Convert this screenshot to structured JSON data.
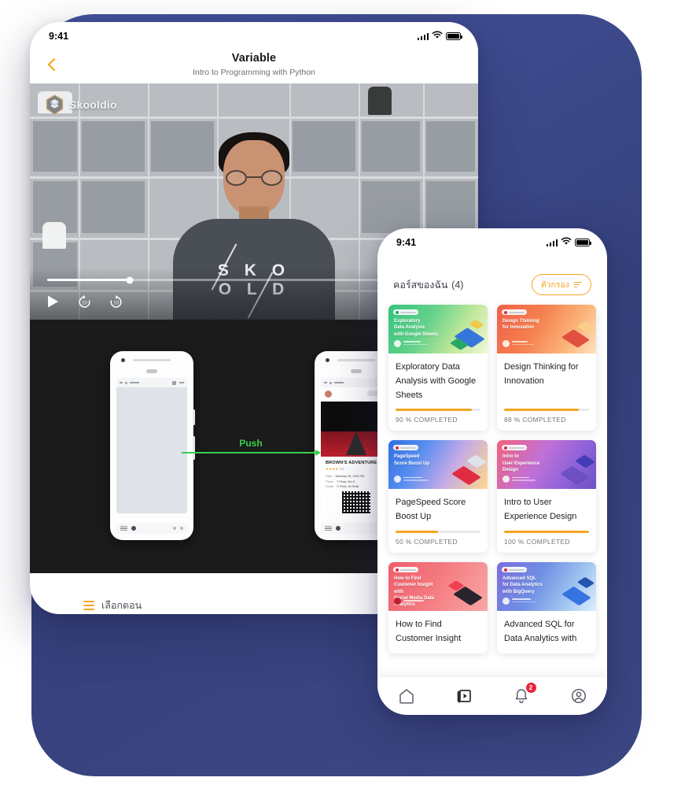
{
  "background": {
    "blob_color": "#3f4c92",
    "page_background": "#ffffff"
  },
  "colors": {
    "accent_orange": "#f5a623",
    "badge_red": "#e8253a",
    "push_green": "#36d04a",
    "text_dark": "#1c1f25",
    "text_muted": "#73787f"
  },
  "phone_lesson": {
    "status_bar": {
      "time": "9:41",
      "signal_icon": "cellular-bars-icon",
      "wifi_icon": "wifi-icon",
      "battery_icon": "battery-icon"
    },
    "nav": {
      "back_icon": "chevron-left-icon",
      "title": "Variable",
      "subtitle": "Intro to Programming with Python"
    },
    "video": {
      "brand_logo_icon": "skooldio-hex-logo-icon",
      "brand_name": "Skooldio",
      "shirt_text_line1": "S K O",
      "shirt_text_line2": "O L D",
      "progress_percent": 20,
      "controls": [
        {
          "name": "play-button",
          "icon": "play-icon"
        },
        {
          "name": "rewind-10-button",
          "icon": "rewind-10-icon"
        },
        {
          "name": "forward-10-button",
          "icon": "forward-10-icon"
        }
      ]
    },
    "slide": {
      "transition_label": "Push",
      "ticket": {
        "title": "BROWN'S ADVENTURE",
        "rating_stars": "★★★★",
        "rating_value": "4.5",
        "rows": [
          {
            "label": "Date",
            "value": "Monday 25, 9:00 PM"
          },
          {
            "label": "Place",
            "value": "7 Floor, No.3"
          },
          {
            "label": "Seats",
            "value": "C Row, 16 Seat"
          }
        ],
        "qr_icon": "qr-code-icon"
      }
    },
    "footer": {
      "list_icon": "episode-list-icon",
      "label": "เลือกตอน"
    }
  },
  "phone_courses": {
    "status_bar": {
      "time": "9:41",
      "signal_icon": "cellular-bars-icon",
      "wifi_icon": "wifi-icon",
      "battery_icon": "battery-icon"
    },
    "header": {
      "title": "คอร์สของฉัน",
      "count": "(4)",
      "filter_label": "ตัวกรอง",
      "filter_icon": "filter-icon"
    },
    "courses": [
      {
        "title": "Exploratory Data Analysis with Google Sheets",
        "thumb_title": "Exploratory\nData Analysis\nwith Google Sheets",
        "progress_label": "90 % COMPLETED",
        "progress_percent": 90,
        "thumb_gradient": "linear-gradient(120deg,#34c47c 0%,#63d18a 38%,#bfe89a 70%,#f2f7d4 100%)",
        "badge_color": "#1fa463"
      },
      {
        "title": "Design Thinking for Innovation",
        "thumb_title": "Design Thinking\nfor Innovation",
        "progress_label": "88 % COMPLETED",
        "progress_percent": 88,
        "thumb_gradient": "linear-gradient(120deg,#f0604b 0%,#f5804f 40%,#fbb377 72%,#fde3c2 100%)",
        "badge_color": "#d8233c"
      },
      {
        "title": "PageSpeed Score Boost Up",
        "thumb_title": "PageSpeed\nScore Boost Up",
        "progress_label": "50 % COMPLETED",
        "progress_percent": 50,
        "thumb_gradient": "linear-gradient(120deg,#2f6fe0 0%,#5a8ef0 32%,#c3a9e8 62%,#ffd98a 100%)",
        "badge_color": "#d8233c"
      },
      {
        "title": "Intro to User Experience Design",
        "thumb_title": "Intro to\nUser Experience Design",
        "progress_label": "100 % COMPLETED",
        "progress_percent": 100,
        "thumb_gradient": "linear-gradient(120deg,#f2627a 0%,#c071d8 42%,#8f63d8 72%,#6d4fc4 100%)",
        "badge_color": "#d8233c"
      },
      {
        "title": "How to Find Customer Insight",
        "thumb_title": "How to Find\nCustomer Insight with\nSocial Media Data Analytics",
        "progress_label": "",
        "progress_percent": 0,
        "thumb_gradient": "linear-gradient(120deg,#ef5d6b 0%,#f4797f 45%,#f9a8a5 100%)",
        "badge_color": "#d8233c"
      },
      {
        "title": "Advanced SQL for Data Analytics with",
        "thumb_title": "Advanced SQL\nfor Data Analytics\nwith BigQuery",
        "progress_label": "",
        "progress_percent": 0,
        "thumb_gradient": "linear-gradient(120deg,#7b6ddb 0%,#6f8fe4 40%,#9fc4ef 72%,#dfeefb 100%)",
        "badge_color": "#d8233c"
      }
    ],
    "tabbar": [
      {
        "name": "tab-home",
        "icon": "home-icon",
        "badge": ""
      },
      {
        "name": "tab-courses",
        "icon": "video-library-icon",
        "badge": ""
      },
      {
        "name": "tab-notifications",
        "icon": "bell-icon",
        "badge": "2"
      },
      {
        "name": "tab-profile",
        "icon": "user-circle-icon",
        "badge": ""
      }
    ]
  }
}
